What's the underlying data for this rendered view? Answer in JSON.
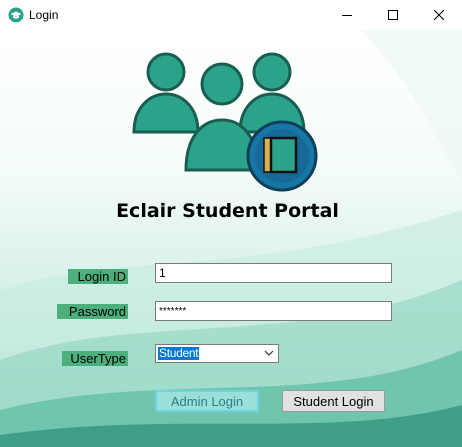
{
  "window": {
    "title": "Login",
    "controls": {
      "minimize": "minimize-icon",
      "maximize": "maximize-icon",
      "close": "close-icon"
    }
  },
  "header": {
    "title": "Eclair Student Portal"
  },
  "form": {
    "login_id_label": "Login ID",
    "login_id_value": "1",
    "password_label": "Password",
    "password_value": "*******",
    "usertype_label": "UserType",
    "usertype_selected": "Student"
  },
  "buttons": {
    "admin_login": "Admin Login",
    "student_login": "Student Login"
  },
  "colors": {
    "accent": "#4bb07c",
    "person_fill": "#2aa38a",
    "person_dark": "#1b5d50",
    "book_circle": "#1677a6",
    "selection": "#0078d7"
  },
  "icons": {
    "app": "graduation-cap-icon",
    "logo": "students-group-book-icon",
    "dropdown": "chevron-down-icon"
  }
}
